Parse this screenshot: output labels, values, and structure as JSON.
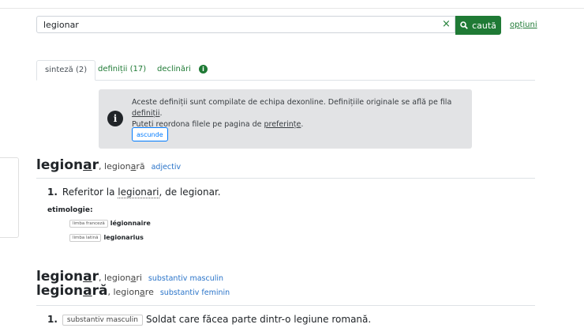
{
  "search": {
    "value": "legionar",
    "clear_icon": "×",
    "button_label": "caută",
    "options_label": "opțiuni"
  },
  "tabs": [
    {
      "label": "sinteză (2)"
    },
    {
      "label": "definiții (17)"
    },
    {
      "label": "declinări"
    }
  ],
  "notice": {
    "line1_prefix": "Aceste definiții sunt compilate de echipa dexonline. Definițiile originale se află pe fila ",
    "line1_link": "definiții",
    "line1_suffix": ".",
    "line2_prefix": "Puteți reordona filele pe pagina de ",
    "line2_link": "preferințe",
    "line2_suffix": ".",
    "hide_label": "ascunde"
  },
  "entry1": {
    "lemma_a": "legion",
    "lemma_b": "a",
    "lemma_c": "r",
    "forms_prefix": ", legion",
    "forms_accent": "a",
    "forms_suffix": "ră",
    "pos": "adjectiv",
    "def_number": "1.",
    "def_prefix": "Referitor la ",
    "def_link": "legionari",
    "def_suffix": ", de legionar.",
    "etym_label": "etimologie:",
    "etym": [
      {
        "lang": "limba franceză",
        "word": "légionnaire"
      },
      {
        "lang": "limba latină",
        "word": "legionarius"
      }
    ]
  },
  "entry2": {
    "line1": {
      "lemma_a": "legion",
      "lemma_b": "a",
      "lemma_c": "r",
      "forms_prefix": ", legion",
      "forms_accent": "a",
      "forms_suffix": "ri",
      "pos": "substantiv masculin"
    },
    "line2": {
      "lemma_a": "legion",
      "lemma_b": "a",
      "lemma_c": "ră",
      "forms_prefix": ", legion",
      "forms_accent": "a",
      "forms_suffix": "re",
      "pos": "substantiv feminin"
    },
    "def_number": "1.",
    "def_tag": "substantiv masculin",
    "def_text": "Soldat care făcea parte dintr-o legiune romană."
  }
}
